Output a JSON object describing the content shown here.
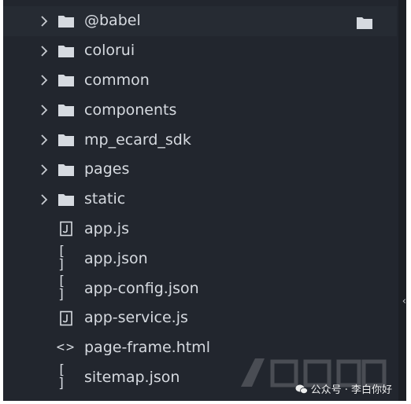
{
  "explorer": {
    "items": [
      {
        "label": "@babel",
        "type": "folder",
        "icon": "folder-icon"
      },
      {
        "label": "colorui",
        "type": "folder",
        "icon": "folder-icon"
      },
      {
        "label": "common",
        "type": "folder",
        "icon": "folder-icon"
      },
      {
        "label": "components",
        "type": "folder",
        "icon": "folder-icon"
      },
      {
        "label": "mp_ecard_sdk",
        "type": "folder",
        "icon": "folder-icon"
      },
      {
        "label": "pages",
        "type": "folder",
        "icon": "folder-icon"
      },
      {
        "label": "static",
        "type": "folder",
        "icon": "folder-icon"
      },
      {
        "label": "app.js",
        "type": "file",
        "icon": "js-file-icon"
      },
      {
        "label": "app.json",
        "type": "file",
        "icon": "json-file-icon",
        "glyph": "[ ]"
      },
      {
        "label": "app-config.json",
        "type": "file",
        "icon": "json-file-icon",
        "glyph": "[ ]"
      },
      {
        "label": "app-service.js",
        "type": "file",
        "icon": "js-file-icon"
      },
      {
        "label": "page-frame.html",
        "type": "file",
        "icon": "html-file-icon",
        "glyph": "<>"
      },
      {
        "label": "sitemap.json",
        "type": "file",
        "icon": "json-file-icon",
        "glyph": "[ ]"
      }
    ]
  },
  "watermark": {
    "text": "公众号 · 李白你好"
  },
  "colors": {
    "background": "#22262e",
    "text": "#d6dae0",
    "icon": "#d6dae0"
  }
}
